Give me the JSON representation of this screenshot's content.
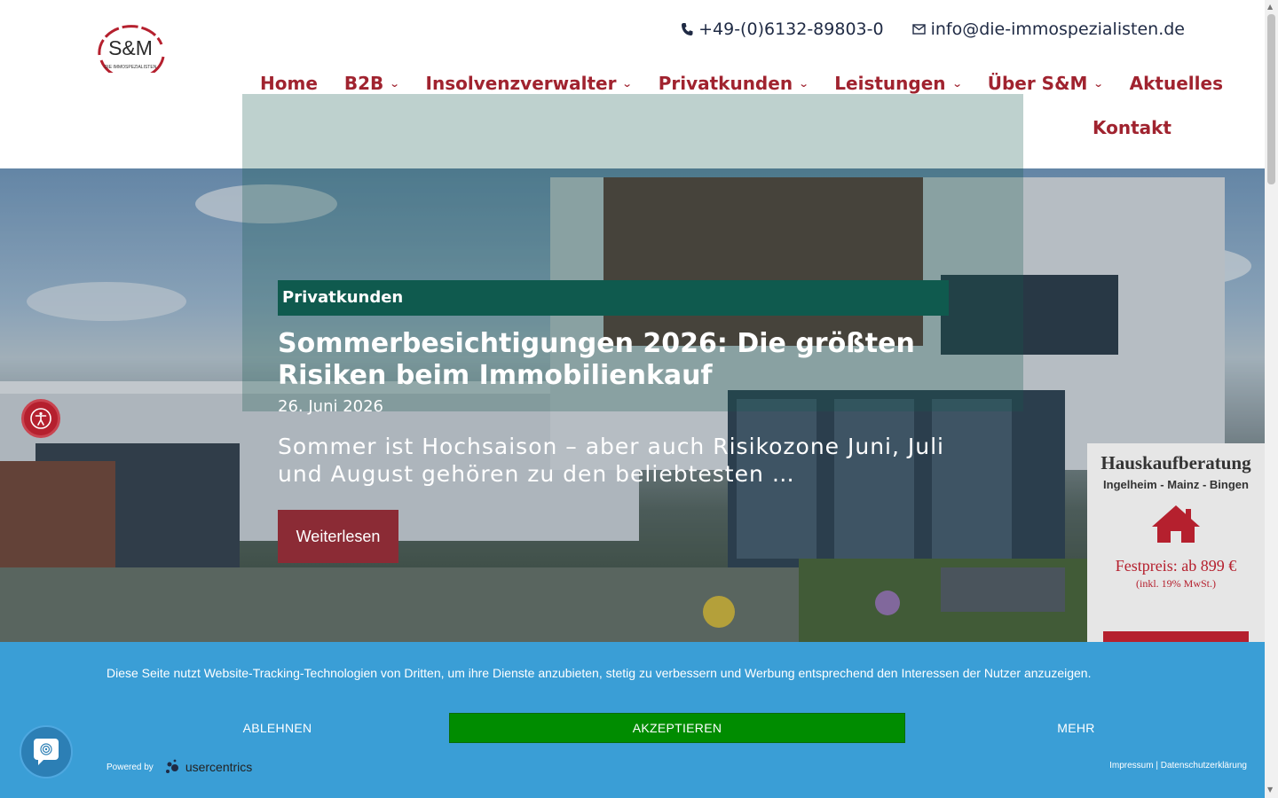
{
  "logo": {
    "text": "S&M",
    "tagline": "DIE IMMOSPEZIALISTEN"
  },
  "contact": {
    "phone": "+49-(0)6132-89803-0",
    "email": "info@die-immospezialisten.de"
  },
  "nav": {
    "items": [
      {
        "label": "Home",
        "has_dropdown": false
      },
      {
        "label": "B2B",
        "has_dropdown": true
      },
      {
        "label": "Insolvenzverwalter",
        "has_dropdown": true
      },
      {
        "label": "Privatkunden",
        "has_dropdown": true
      },
      {
        "label": "Leistungen",
        "has_dropdown": true
      },
      {
        "label": "Über S&M",
        "has_dropdown": true
      },
      {
        "label": "Aktuelles",
        "has_dropdown": false
      }
    ],
    "row2": {
      "label": "Kontakt"
    }
  },
  "hero": {
    "category": "Privatkunden",
    "title": "Sommerbesichtigungen 2026: Die größten Risiken beim Immobilienkauf",
    "date": "26. Juni 2026",
    "excerpt": "Sommer ist Hochsaison – aber auch Risikozone Juni, Juli und August gehören zu den beliebtesten …",
    "button": "Weiterlesen"
  },
  "widget": {
    "title": "Hauskaufberatung",
    "subtitle": "Ingelheim - Mainz - Bingen",
    "price": "Festpreis: ab 899 €",
    "vat": "(inkl. 19% MwSt.)"
  },
  "cookie": {
    "text": "Diese Seite nutzt Website-Tracking-Technologien von Dritten, um ihre Dienste anzubieten, stetig zu verbessern und Werbung entsprechend den Interessen der Nutzer anzuzeigen.",
    "decline": "ABLEHNEN",
    "accept": "AKZEPTIEREN",
    "more": "MEHR",
    "powered_by": "Powered by",
    "brand": "usercentrics",
    "legal": "Impressum | Datenschutzerklärung"
  },
  "colors": {
    "brand_red": "#a0232f",
    "category_green": "#0f5a4e",
    "cookie_blue": "#3a9ed6",
    "accept_green": "#008c00"
  }
}
